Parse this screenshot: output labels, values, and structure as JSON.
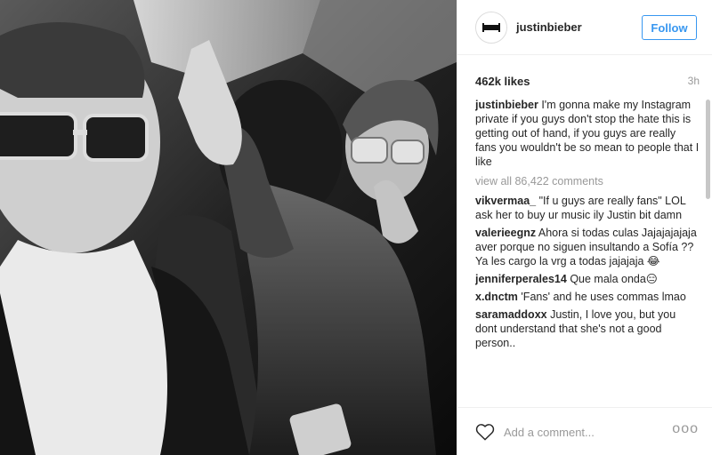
{
  "post": {
    "username": "justinbieber",
    "follow_label": "Follow",
    "likes": "462k likes",
    "time": "3h",
    "caption": "I'm gonna make my Instagram private if you guys don't stop the hate this is getting out of hand, if you guys are really fans you wouldn't be so mean to people that I like",
    "view_all": "view all 86,422 comments"
  },
  "comments": [
    {
      "user": "vikvermaa_",
      "text": "\"If u guys are really fans\" LOL ask her to buy ur music ily Justin bit damn"
    },
    {
      "user": "valerieegnz",
      "text": "Ahora si todas culas Jajajajajaja aver porque no siguen insultando a Sofía ?? Ya les cargo la vrg a todas jajajaja 😂"
    },
    {
      "user": "jenniferperales14",
      "text": "Que mala onda😑"
    },
    {
      "user": "x.dnctm",
      "text": "'Fans' and he uses commas lmao"
    },
    {
      "user": "saramaddoxx",
      "text": "Justin, I love you, but you dont understand that she's not a good person.."
    }
  ],
  "footer": {
    "placeholder": "Add a comment...",
    "more": "ooo"
  },
  "icons": {
    "heart": "heart-icon",
    "more": "more-options-icon"
  },
  "colors": {
    "accent": "#3897f0",
    "muted": "#999999",
    "text": "#262626"
  }
}
